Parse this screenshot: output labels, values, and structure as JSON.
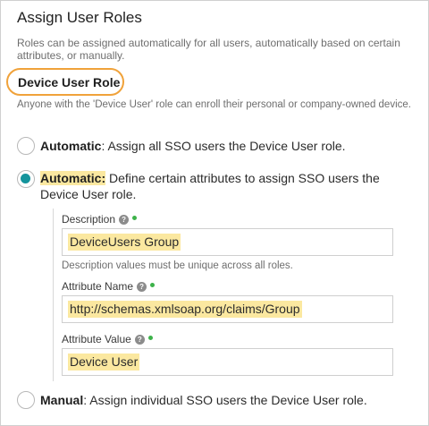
{
  "page": {
    "title": "Assign User Roles",
    "description": "Roles can be assigned automatically for all users, automatically based on certain attributes, or manually."
  },
  "section": {
    "title": "Device User Role",
    "description": "Anyone with the 'Device User' role can enroll their personal or company-owned device."
  },
  "options": [
    {
      "label": "Automatic",
      "text": ": Assign all SSO users the Device User role.",
      "selected": false
    },
    {
      "label": "Automatic:",
      "text": " Define certain attributes to assign SSO users the Device User role.",
      "selected": true
    },
    {
      "label": "Manual",
      "text": ": Assign individual SSO users the Device User role.",
      "selected": false
    }
  ],
  "fields": {
    "description": {
      "label": "Description",
      "value": "DeviceUsers Group",
      "hint": "Description values must be unique across all roles."
    },
    "attribute_name": {
      "label": "Attribute Name",
      "value": "http://schemas.xmlsoap.org/claims/Group"
    },
    "attribute_value": {
      "label": "Attribute Value",
      "value": "Device User"
    }
  },
  "icons": {
    "help": "help-icon",
    "required": "required-dot-icon"
  },
  "colors": {
    "accent": "#14949c",
    "highlight": "#fbe8a0",
    "callout": "#f0a23a",
    "required": "#3db24a"
  }
}
